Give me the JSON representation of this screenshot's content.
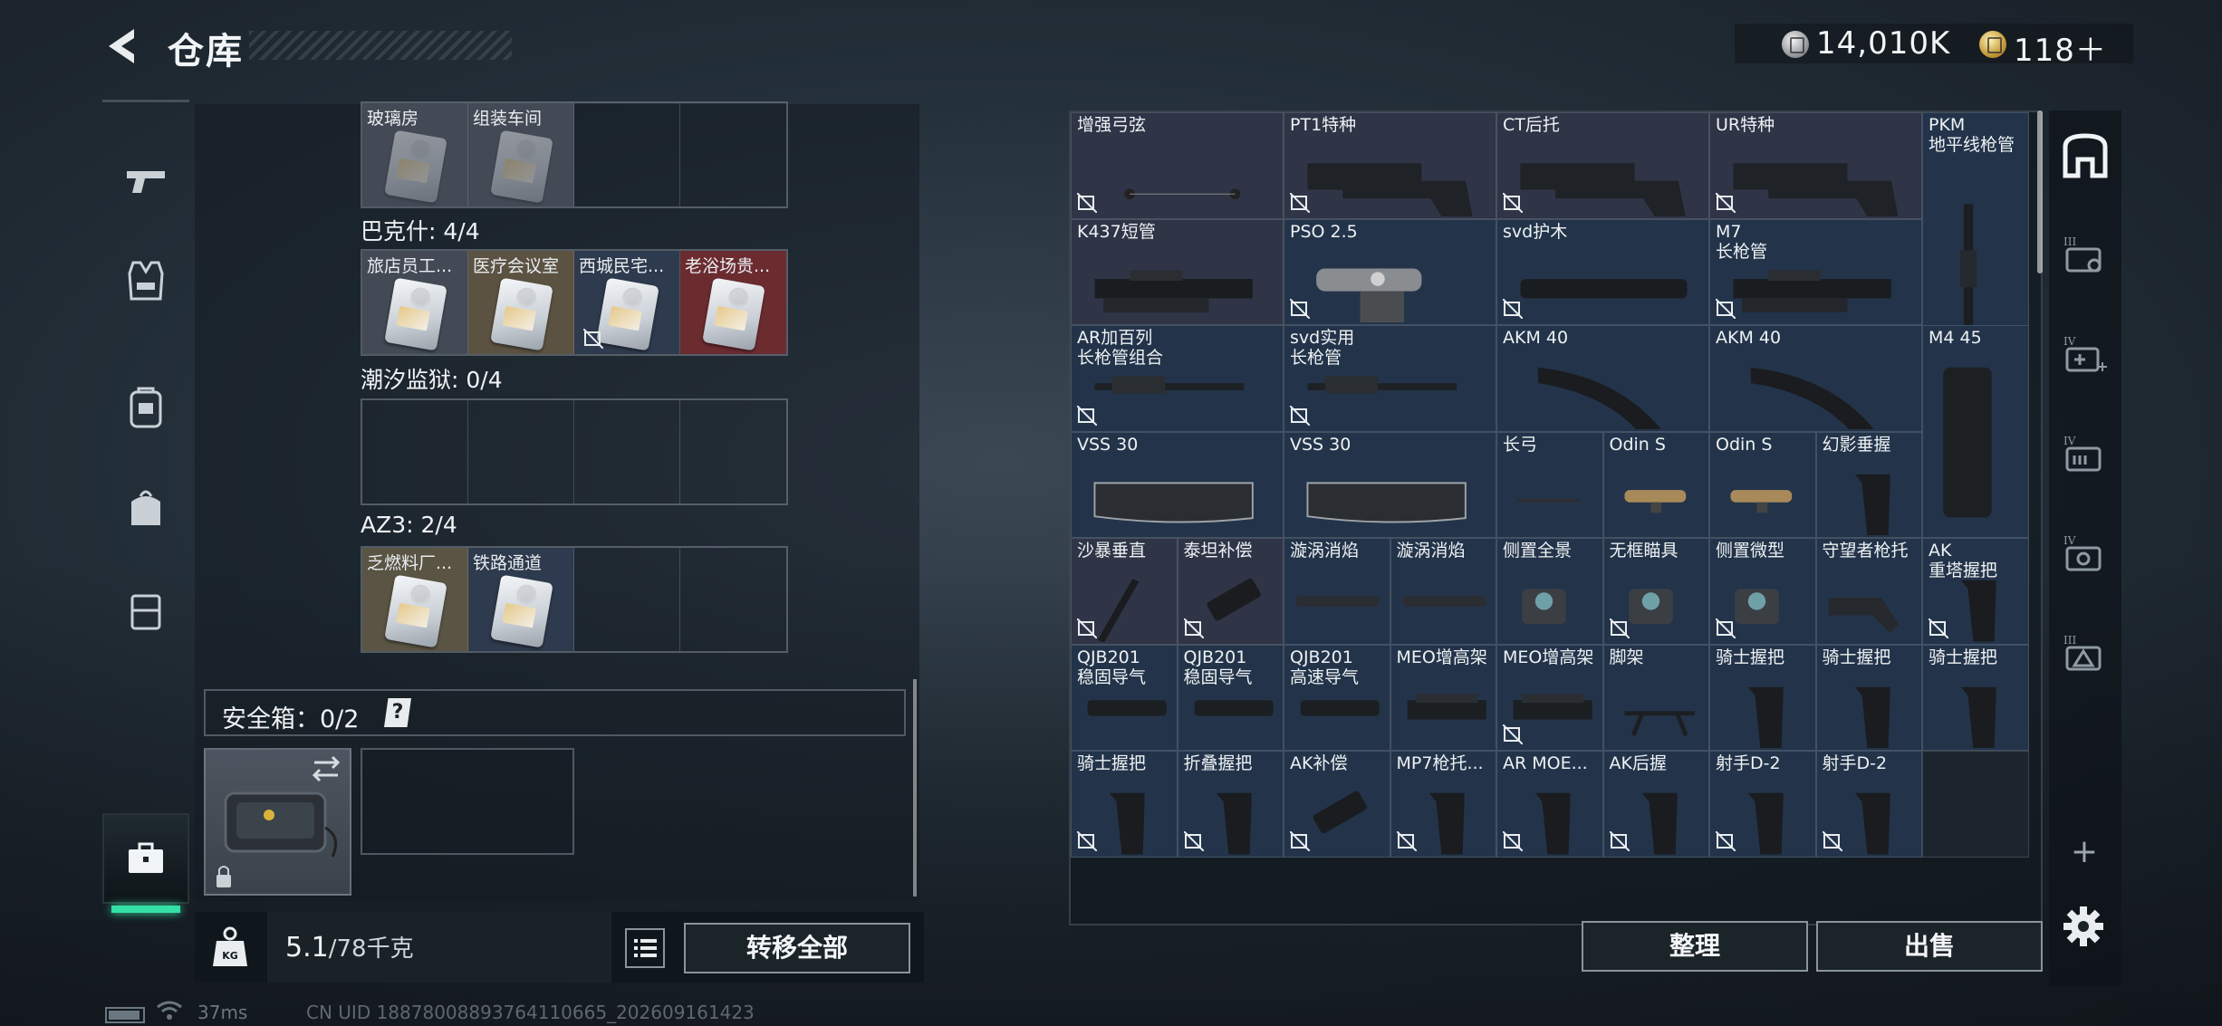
{
  "header": {
    "title": "仓库"
  },
  "currency": {
    "silver": "14,010K",
    "gold": "118＋"
  },
  "left_nav": [
    "pistol-icon",
    "vest-icon",
    "backpack-icon",
    "bag-icon",
    "armor-icon",
    "toolbox-icon"
  ],
  "keycards": {
    "group0": {
      "cells": [
        "玻璃房",
        "组装车间",
        "",
        ""
      ]
    },
    "group1": {
      "title": "巴克什: 4/4",
      "cells": [
        "旅店员工...",
        "医疗会议室",
        "西城民宅...",
        "老浴场贵..."
      ]
    },
    "group2": {
      "title": "潮汐监狱: 0/4",
      "cells": [
        "",
        "",
        "",
        ""
      ]
    },
    "group3": {
      "title": "AZ3: 2/4",
      "cells": [
        "乏燃料厂...",
        "铁路通道",
        "",
        ""
      ]
    }
  },
  "safe_box": {
    "title": "安全箱：0/2",
    "help": "?"
  },
  "weight": {
    "current": "5.1",
    "cap": "/78千克"
  },
  "buttons": {
    "transfer_all": "转移全部",
    "sort": "整理",
    "sell": "出售"
  },
  "inventory": {
    "r0": [
      "增强弓弦",
      "PT1特种",
      "CT后托",
      "UR特种",
      "PKM\n地平线枪管"
    ],
    "r1": [
      "K437短管",
      "PSO 2.5",
      "svd护木",
      "M7\n长枪管"
    ],
    "r2": [
      "AR加百列\n长枪管组合",
      "svd实用\n长枪管",
      "AKM 40",
      "AKM 40",
      "M4 45"
    ],
    "r3": [
      "VSS 30",
      "VSS 30",
      "长弓",
      "Odin S",
      "Odin S",
      "幻影垂握"
    ],
    "r4": [
      "沙暴垂直",
      "泰坦补偿",
      "漩涡消焰",
      "漩涡消焰",
      "侧置全景",
      "无框瞄具",
      "侧置微型",
      "守望者枪托",
      "AK\n重塔握把"
    ],
    "r5": [
      "QJB201\n稳固导气",
      "QJB201\n稳固导气",
      "QJB201\n高速导气",
      "MEO增高架",
      "MEO增高架",
      "脚架",
      "骑士握把",
      "骑士握把",
      "骑士握把"
    ],
    "r6": [
      "骑士握把",
      "折叠握把",
      "AK补偿",
      "MP7枪托...",
      "AR MOE...",
      "AK后握",
      "射手D-2",
      "射手D-2"
    ]
  },
  "status": {
    "ping": "37ms",
    "uid": "CN UID 18878008893764110665_202609161423"
  }
}
